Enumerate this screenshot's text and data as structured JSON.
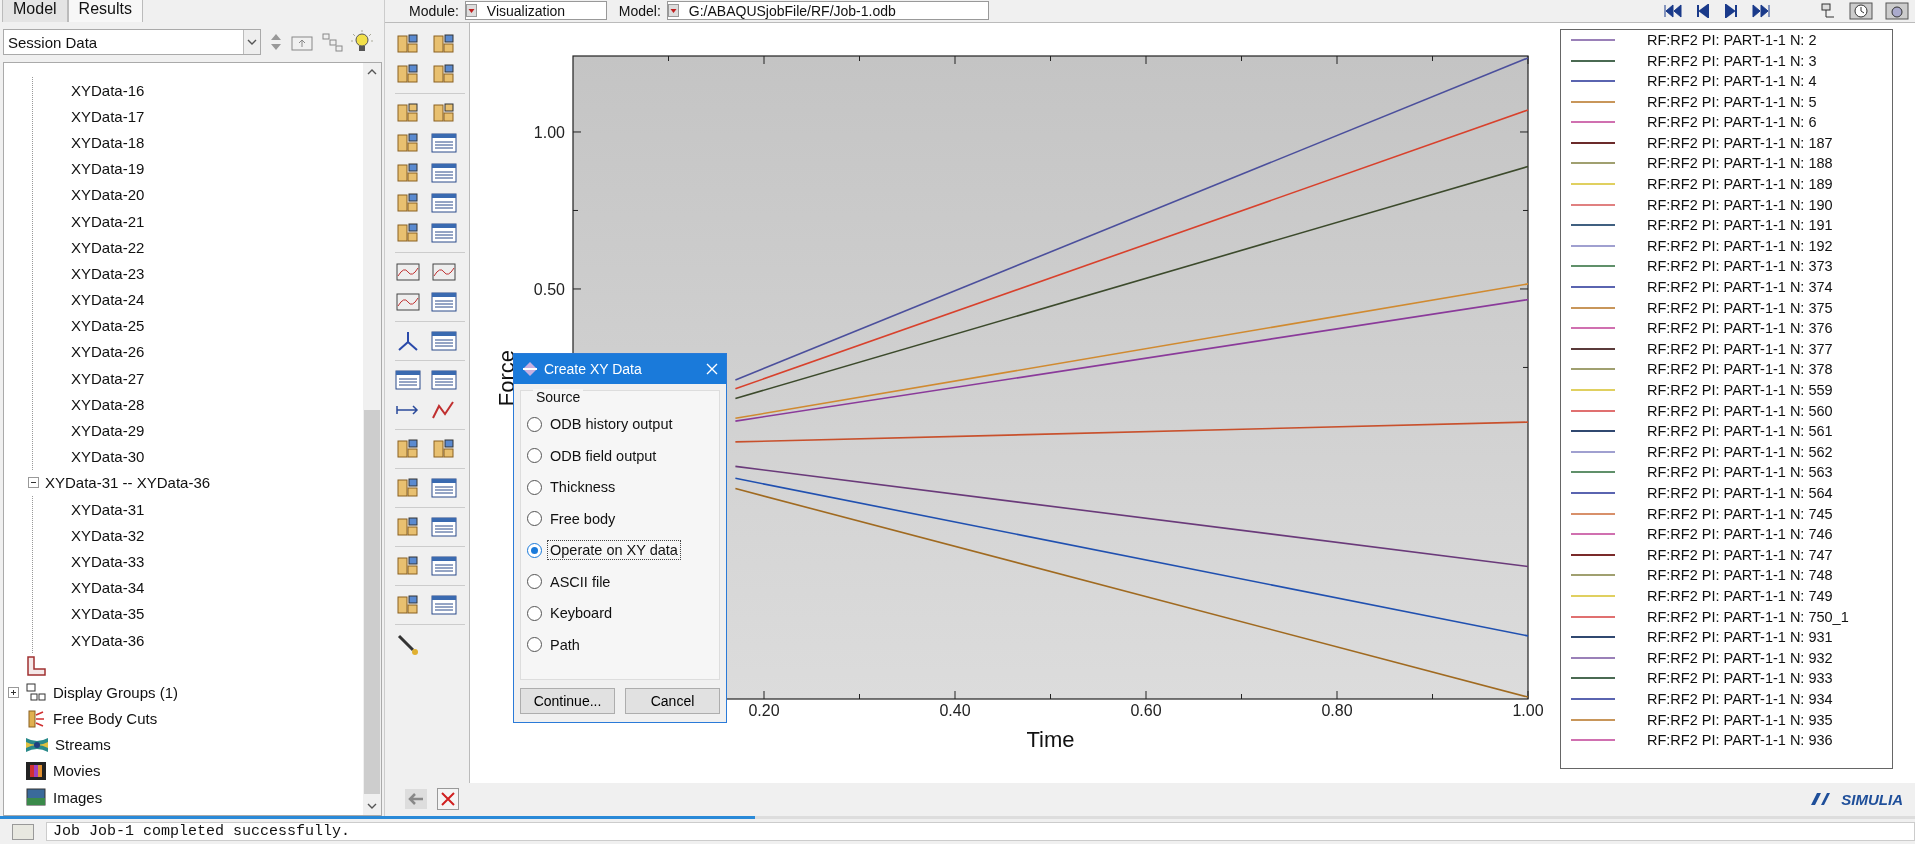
{
  "tabs": [
    {
      "label": "Model",
      "selected": false
    },
    {
      "label": "Results",
      "selected": true
    }
  ],
  "session_select": {
    "value": "Session Data"
  },
  "tree": {
    "items": [
      "XYData-16",
      "XYData-17",
      "XYData-18",
      "XYData-19",
      "XYData-20",
      "XYData-21",
      "XYData-22",
      "XYData-23",
      "XYData-24",
      "XYData-25",
      "XYData-26",
      "XYData-27",
      "XYData-28",
      "XYData-29",
      "XYData-30"
    ],
    "group": {
      "label": "XYData-31 -- XYData-36",
      "expanded": true,
      "children": [
        "XYData-31",
        "XYData-32",
        "XYData-33",
        "XYData-34",
        "XYData-35",
        "XYData-36"
      ]
    },
    "containers": [
      {
        "kind": "paths"
      },
      {
        "kind": "display-groups",
        "label": "Display Groups (1)",
        "expanded": false
      },
      {
        "kind": "free-body",
        "label": "Free Body Cuts"
      },
      {
        "kind": "streams",
        "label": "Streams"
      },
      {
        "kind": "movies",
        "label": "Movies"
      },
      {
        "kind": "images",
        "label": "Images"
      }
    ]
  },
  "top_bar": {
    "module_label": "Module:",
    "module": "Visualization",
    "model_label": "Model:",
    "model": "G:/ABAQUSjobFile/RF/Job-1.odb"
  },
  "viewport": {
    "chart_data": {
      "type": "line",
      "xlabel": "Time",
      "ylabel": "Force",
      "x": [
        0.17,
        1
      ],
      "series": [
        {
          "color": "#4b4f9c",
          "values": [
            0.21,
            1.236
          ]
        },
        {
          "color": "#d8412c",
          "values": [
            0.182,
            1.07
          ]
        },
        {
          "color": "#3c4a2c",
          "values": [
            0.151,
            0.89
          ]
        },
        {
          "color": "#d08a30",
          "values": [
            0.088,
            0.516
          ]
        },
        {
          "color": "#8a3a9a",
          "values": [
            0.079,
            0.466
          ]
        },
        {
          "color": "#c8502c",
          "values": [
            0.013,
            0.076
          ]
        },
        {
          "color": "#6a3a7a",
          "values": [
            -0.065,
            -0.384
          ]
        },
        {
          "color": "#2050b0",
          "values": [
            -0.103,
            -0.605
          ]
        },
        {
          "color": "#a06a20",
          "values": [
            -0.136,
            -0.8
          ]
        }
      ],
      "xlim": [
        0,
        1
      ],
      "ylim": [
        -0.806,
        1.242
      ],
      "xticks": [
        {
          "value": 0.2,
          "label": "0.20"
        },
        {
          "value": 0.4,
          "label": "0.40"
        },
        {
          "value": 0.6,
          "label": "0.60"
        },
        {
          "value": 0.8,
          "label": "0.80"
        },
        {
          "value": 1,
          "label": "1.00"
        }
      ],
      "yticks": [
        {
          "value": 0.5,
          "label": "0.50"
        },
        {
          "value": 1,
          "label": "1.00"
        }
      ]
    }
  },
  "legend": {
    "entries": [
      {
        "label": "RF:RF2 PI: PART-1-1 N: 2",
        "color": "#9a80b8"
      },
      {
        "label": "RF:RF2 PI: PART-1-1 N: 3",
        "color": "#4a6a52"
      },
      {
        "label": "RF:RF2 PI: PART-1-1 N: 4",
        "color": "#5a64b0"
      },
      {
        "label": "RF:RF2 PI: PART-1-1 N: 5",
        "color": "#c8965a"
      },
      {
        "label": "RF:RF2 PI: PART-1-1 N: 6",
        "color": "#d070b0"
      },
      {
        "label": "RF:RF2 PI: PART-1-1 N: 187",
        "color": "#6b2a2a"
      },
      {
        "label": "RF:RF2 PI: PART-1-1 N: 188",
        "color": "#a0a070"
      },
      {
        "label": "RF:RF2 PI: PART-1-1 N: 189",
        "color": "#e0d060"
      },
      {
        "label": "RF:RF2 PI: PART-1-1 N: 190",
        "color": "#e08080"
      },
      {
        "label": "RF:RF2 PI: PART-1-1 N: 191",
        "color": "#406080"
      },
      {
        "label": "RF:RF2 PI: PART-1-1 N: 192",
        "color": "#a0a0d0"
      },
      {
        "label": "RF:RF2 PI: PART-1-1 N: 373",
        "color": "#60906a"
      },
      {
        "label": "RF:RF2 PI: PART-1-1 N: 374",
        "color": "#5a64b0"
      },
      {
        "label": "RF:RF2 PI: PART-1-1 N: 375",
        "color": "#c8965a"
      },
      {
        "label": "RF:RF2 PI: PART-1-1 N: 376",
        "color": "#d070b0"
      },
      {
        "label": "RF:RF2 PI: PART-1-1 N: 377",
        "color": "#5a3a3a"
      },
      {
        "label": "RF:RF2 PI: PART-1-1 N: 378",
        "color": "#a0a070"
      },
      {
        "label": "RF:RF2 PI: PART-1-1 N: 559",
        "color": "#e0d060"
      },
      {
        "label": "RF:RF2 PI: PART-1-1 N: 560",
        "color": "#e07070"
      },
      {
        "label": "RF:RF2 PI: PART-1-1 N: 561",
        "color": "#304870"
      },
      {
        "label": "RF:RF2 PI: PART-1-1 N: 562",
        "color": "#a0a0d0"
      },
      {
        "label": "RF:RF2 PI: PART-1-1 N: 563",
        "color": "#60906a"
      },
      {
        "label": "RF:RF2 PI: PART-1-1 N: 564",
        "color": "#5a64b0"
      },
      {
        "label": "RF:RF2 PI: PART-1-1 N: 745",
        "color": "#d8906a"
      },
      {
        "label": "RF:RF2 PI: PART-1-1 N: 746",
        "color": "#d070b0"
      },
      {
        "label": "RF:RF2 PI: PART-1-1 N: 747",
        "color": "#7a2a2a"
      },
      {
        "label": "RF:RF2 PI: PART-1-1 N: 748",
        "color": "#a0a070"
      },
      {
        "label": "RF:RF2 PI: PART-1-1 N: 749",
        "color": "#e0d060"
      },
      {
        "label": "RF:RF2 PI: PART-1-1 N: 750_1",
        "color": "#e07070"
      },
      {
        "label": "RF:RF2 PI: PART-1-1 N: 931",
        "color": "#304870"
      },
      {
        "label": "RF:RF2 PI: PART-1-1 N: 932",
        "color": "#9a80b8"
      },
      {
        "label": "RF:RF2 PI: PART-1-1 N: 933",
        "color": "#4a6a52"
      },
      {
        "label": "RF:RF2 PI: PART-1-1 N: 934",
        "color": "#5a64b0"
      },
      {
        "label": "RF:RF2 PI: PART-1-1 N: 935",
        "color": "#c8965a"
      },
      {
        "label": "RF:RF2 PI: PART-1-1 N: 936",
        "color": "#d070b0"
      }
    ]
  },
  "dialog": {
    "title": "Create XY Data",
    "group_label": "Source",
    "options": [
      {
        "label": "ODB history output",
        "selected": false
      },
      {
        "label": "ODB field output",
        "selected": false
      },
      {
        "label": "Thickness",
        "selected": false
      },
      {
        "label": "Free body",
        "selected": false
      },
      {
        "label": "Operate on XY data",
        "selected": true
      },
      {
        "label": "ASCII file",
        "selected": false
      },
      {
        "label": "Keyboard",
        "selected": false
      },
      {
        "label": "Path",
        "selected": false
      }
    ],
    "buttons": [
      "Continue...",
      "Cancel"
    ]
  },
  "logo": "SIMULIA",
  "status": "Job Job-1 completed successfully."
}
